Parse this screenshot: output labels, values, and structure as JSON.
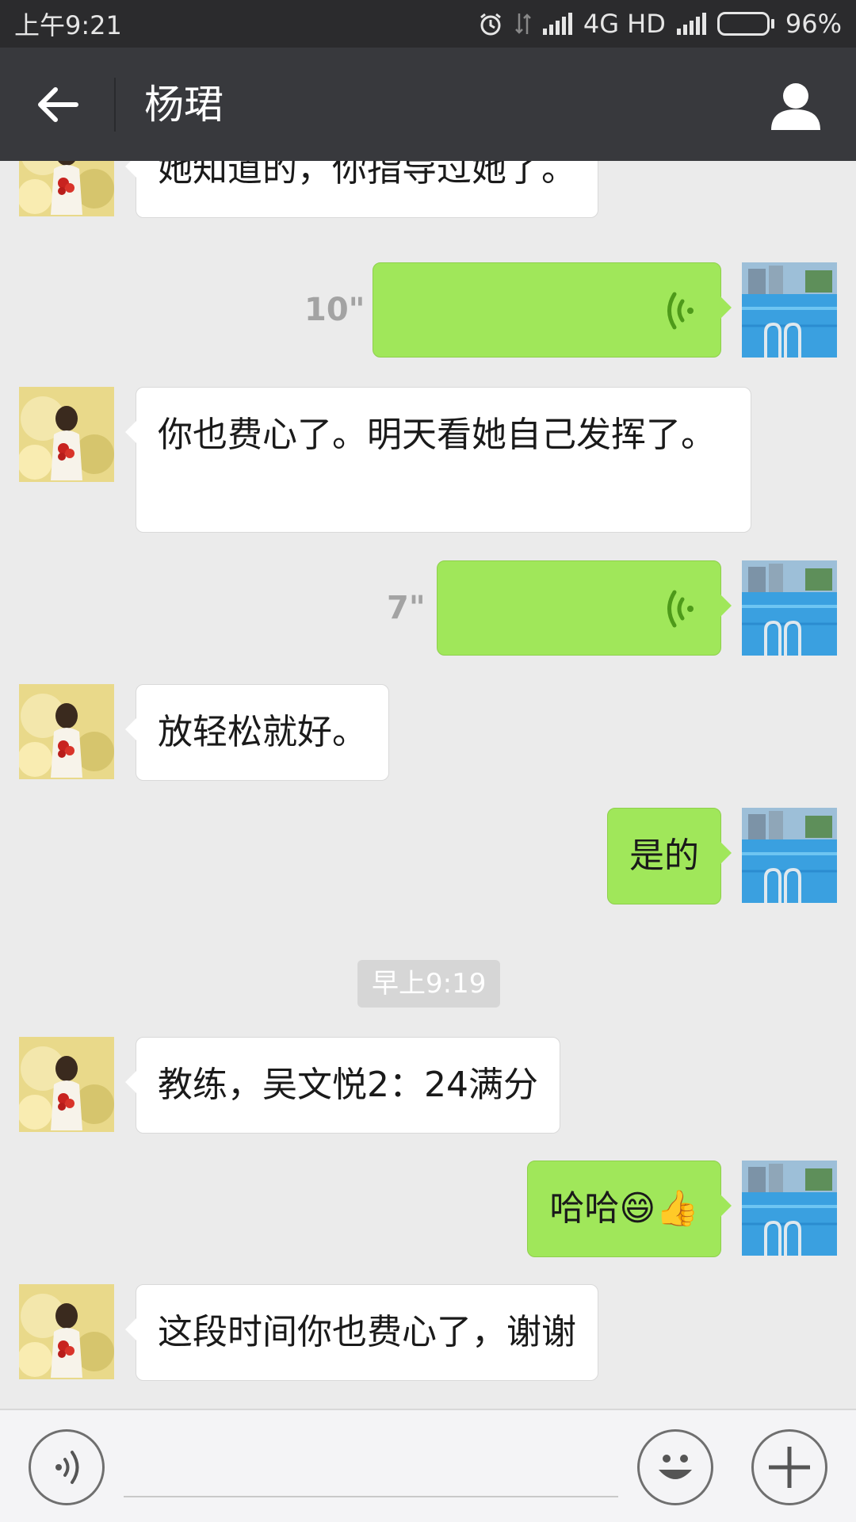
{
  "status_bar": {
    "time": "上午9:21",
    "network": "4G HD",
    "battery": "96%",
    "battery_level": 0.96
  },
  "header": {
    "title": "杨珺",
    "back_icon": "arrow-left-icon",
    "profile_icon": "person-icon"
  },
  "messages": [
    {
      "side": "in",
      "type": "text",
      "text": "她知道的，你指导过她了。"
    },
    {
      "side": "out",
      "type": "voice",
      "duration": "10\""
    },
    {
      "side": "in",
      "type": "text",
      "text": "你也费心了。明天看她自己发挥了。"
    },
    {
      "side": "out",
      "type": "voice",
      "duration": "7\""
    },
    {
      "side": "in",
      "type": "text",
      "text": "放轻松就好。"
    },
    {
      "side": "out",
      "type": "text",
      "text": "是的"
    },
    {
      "side": "in",
      "type": "text",
      "text": "教练，吴文悦2：24满分"
    },
    {
      "side": "out",
      "type": "text",
      "text": "哈哈😄👍"
    },
    {
      "side": "in",
      "type": "text",
      "text": "这段时间你也费心了，谢谢"
    }
  ],
  "timestamp": "早上9:19",
  "input_bar": {
    "placeholder": "",
    "voice_icon": "voice-input-icon",
    "emoji_icon": "smiley-icon",
    "plus_icon": "plus-icon"
  },
  "colors": {
    "header_bg": "#38393d",
    "status_bg": "#2b2b2d",
    "chat_bg": "#ebebeb",
    "out_bubble": "#a0e75a",
    "in_bubble": "#ffffff",
    "voice_wave": "#4e9a1a"
  }
}
